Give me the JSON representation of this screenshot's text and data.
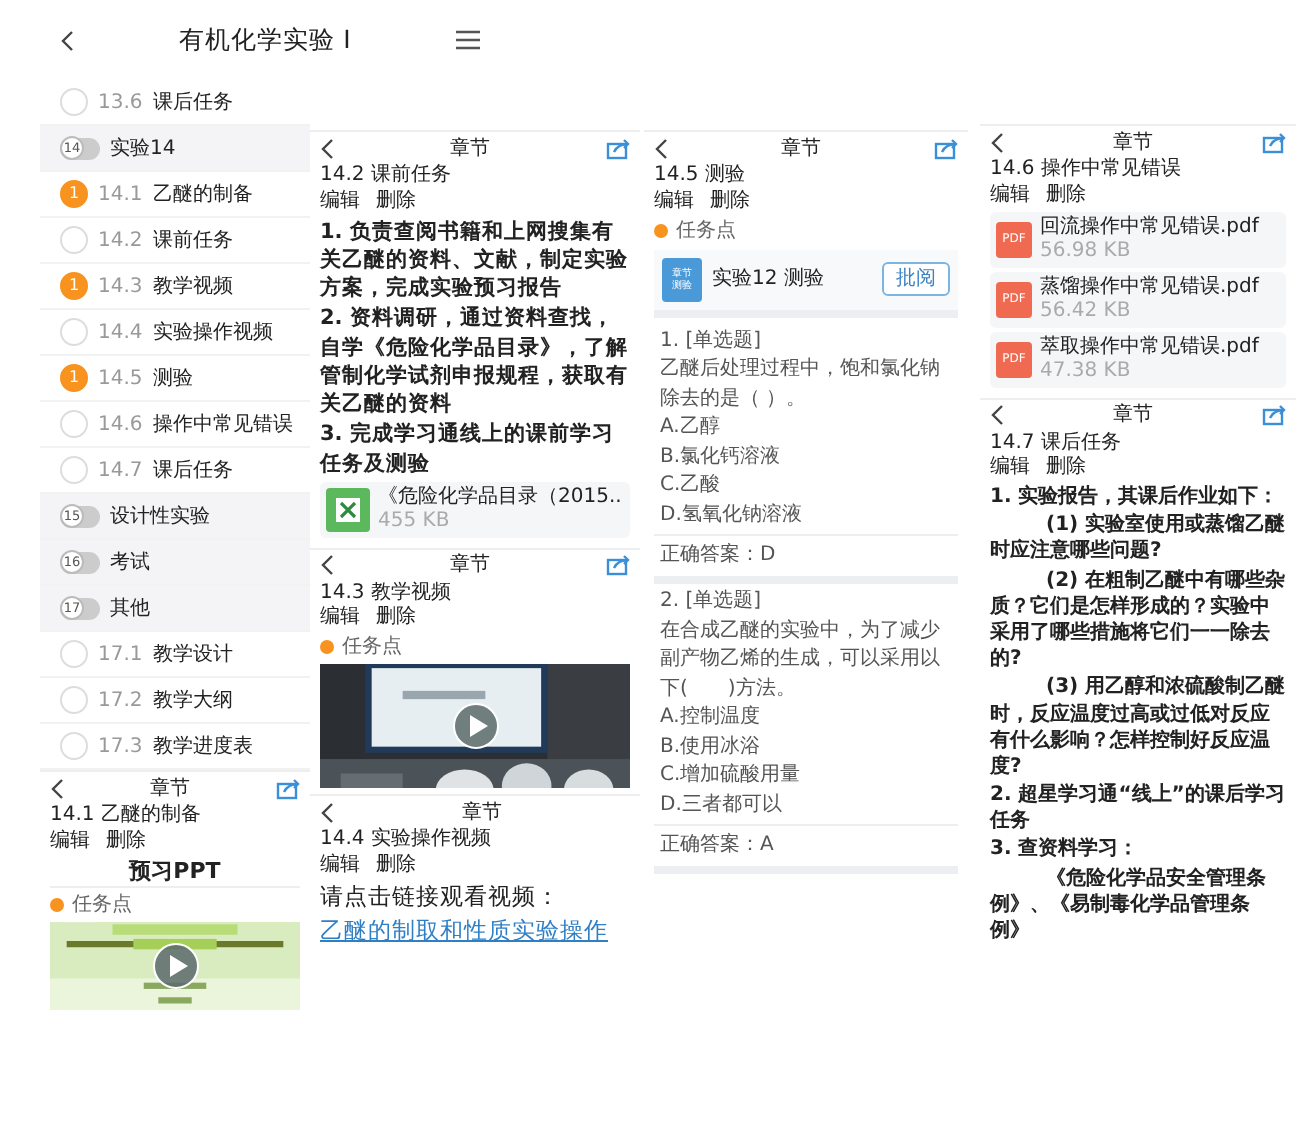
{
  "columns": [
    {
      "course_list": {
        "title": "有机化学实验 I",
        "items": [
          {
            "kind": "lesson",
            "number": "13.6",
            "label": "课后任务"
          },
          {
            "kind": "chapter",
            "number": "14",
            "label": "实验14"
          },
          {
            "kind": "lesson",
            "number": "14.1",
            "label": "乙醚的制备",
            "badge": "1"
          },
          {
            "kind": "lesson",
            "number": "14.2",
            "label": "课前任务"
          },
          {
            "kind": "lesson",
            "number": "14.3",
            "label": "教学视频",
            "badge": "1"
          },
          {
            "kind": "lesson",
            "number": "14.4",
            "label": "实验操作视频"
          },
          {
            "kind": "lesson",
            "number": "14.5",
            "label": "测验",
            "badge": "1"
          },
          {
            "kind": "lesson",
            "number": "14.6",
            "label": "操作中常见错误"
          },
          {
            "kind": "lesson",
            "number": "14.7",
            "label": "课后任务"
          },
          {
            "kind": "chapter",
            "number": "15",
            "label": "设计性实验"
          },
          {
            "kind": "chapter",
            "number": "16",
            "label": "考试"
          },
          {
            "kind": "chapter",
            "number": "17",
            "label": "其他"
          },
          {
            "kind": "lesson",
            "number": "17.1",
            "label": "教学设计"
          },
          {
            "kind": "lesson",
            "number": "17.2",
            "label": "教学大纲"
          },
          {
            "kind": "lesson",
            "number": "17.3",
            "label": "教学进度表"
          }
        ]
      },
      "panels": [
        {
          "header": "章节",
          "share": true,
          "title": "14.1 乙醚的制备",
          "actions": [
            "编辑",
            "删除"
          ],
          "blocks": [
            {
              "kind": "heading",
              "text": "预习PPT"
            },
            {
              "kind": "tag",
              "text": "任务点"
            },
            {
              "kind": "slides_preview"
            }
          ]
        }
      ]
    },
    {
      "panels": [
        {
          "header": "章节",
          "share": true,
          "title": "14.2 课前任务",
          "actions": [
            "编辑",
            "删除"
          ],
          "blocks": [
            {
              "kind": "paragraph",
              "text": "1. 负责查阅书籍和上网搜集有关乙醚的资料、文献，制定实验方案，完成实验预习报告"
            },
            {
              "kind": "paragraph",
              "text": "2. 资料调研，通过资料查找，自学《危险化学品目录》，了解管制化学试剂申报规程，获取有关乙醚的资料"
            },
            {
              "kind": "paragraph",
              "text": "3. 完成学习通线上的课前学习任务及测验"
            },
            {
              "kind": "spreadsheet_file",
              "name": "《危险化学品目录（2015..",
              "size": "455 KB"
            }
          ]
        },
        {
          "header": "章节",
          "share": true,
          "title": "14.3 教学视频",
          "actions": [
            "编辑",
            "删除"
          ],
          "blocks": [
            {
              "kind": "tag",
              "text": "任务点"
            },
            {
              "kind": "video"
            }
          ]
        },
        {
          "header": "章节",
          "share": false,
          "title": "14.4 实验操作视频",
          "actions": [
            "编辑",
            "删除"
          ],
          "blocks": [
            {
              "kind": "lead",
              "text": "请点击链接观看视频："
            },
            {
              "kind": "link",
              "text": "乙醚的制取和性质实验操作"
            }
          ]
        }
      ]
    },
    {
      "panels": [
        {
          "header": "章节",
          "share": true,
          "title": "14.5 测验",
          "actions": [
            "编辑",
            "删除"
          ],
          "blocks": [
            {
              "kind": "tag",
              "text": "任务点"
            },
            {
              "kind": "quiz",
              "icon_lines": [
                "章节",
                "测验"
              ],
              "title": "实验12 测验",
              "button": "批阅"
            },
            {
              "kind": "question",
              "number": "1. [单选题]",
              "text": "乙醚后处理过程中，饱和氯化钠除去的是（ ）。",
              "options": [
                "A.乙醇",
                "B.氯化钙溶液",
                "C.乙酸",
                "D.氢氧化钠溶液"
              ],
              "answer": "正确答案：D"
            },
            {
              "kind": "question",
              "number": "2. [单选题]",
              "text": "在合成乙醚的实验中，为了减少副产物乙烯的生成，可以采用以下(　　)方法。",
              "options": [
                "A.控制温度",
                "B.使用冰浴",
                "C.增加硫酸用量",
                "D.三者都可以"
              ],
              "answer": "正确答案：A"
            }
          ]
        }
      ]
    },
    {
      "panels": [
        {
          "header": "章节",
          "share": true,
          "title": "14.6 操作中常见错误",
          "actions": [
            "编辑",
            "删除"
          ],
          "blocks": [
            {
              "kind": "pdf_file",
              "icon_text": "PDF",
              "name": "回流操作中常见错误.pdf",
              "size": "56.98 KB"
            },
            {
              "kind": "pdf_file",
              "icon_text": "PDF",
              "name": "蒸馏操作中常见错误.pdf",
              "size": "56.42 KB"
            },
            {
              "kind": "pdf_file",
              "icon_text": "PDF",
              "name": "萃取操作中常见错误.pdf",
              "size": "47.38 KB"
            }
          ]
        },
        {
          "header": "章节",
          "share": true,
          "title": "14.7 课后任务",
          "actions": [
            "编辑",
            "删除"
          ],
          "blocks": [
            {
              "kind": "paragraph",
              "text": "1. 实验报告，其课后作业如下："
            },
            {
              "kind": "indented_paragraph",
              "text": "(1) 实验室使用或蒸馏乙醚时应注意哪些问题?"
            },
            {
              "kind": "indented_paragraph",
              "text": "(2) 在粗制乙醚中有哪些杂质？它们是怎样形成的？实验中采用了哪些措施将它们一一除去的?"
            },
            {
              "kind": "indented_paragraph",
              "text": "(3) 用乙醇和浓硫酸制乙醚时，反应温度过高或过低对反应有什么影响？怎样控制好反应温度?"
            },
            {
              "kind": "paragraph",
              "text": "2. 超星学习通“线上”的课后学习任务"
            },
            {
              "kind": "paragraph",
              "text": "3. 查资料学习："
            },
            {
              "kind": "indented_paragraph",
              "text": "《危险化学品安全管理条例》、《易制毒化学品管理条例》"
            }
          ]
        }
      ]
    }
  ]
}
